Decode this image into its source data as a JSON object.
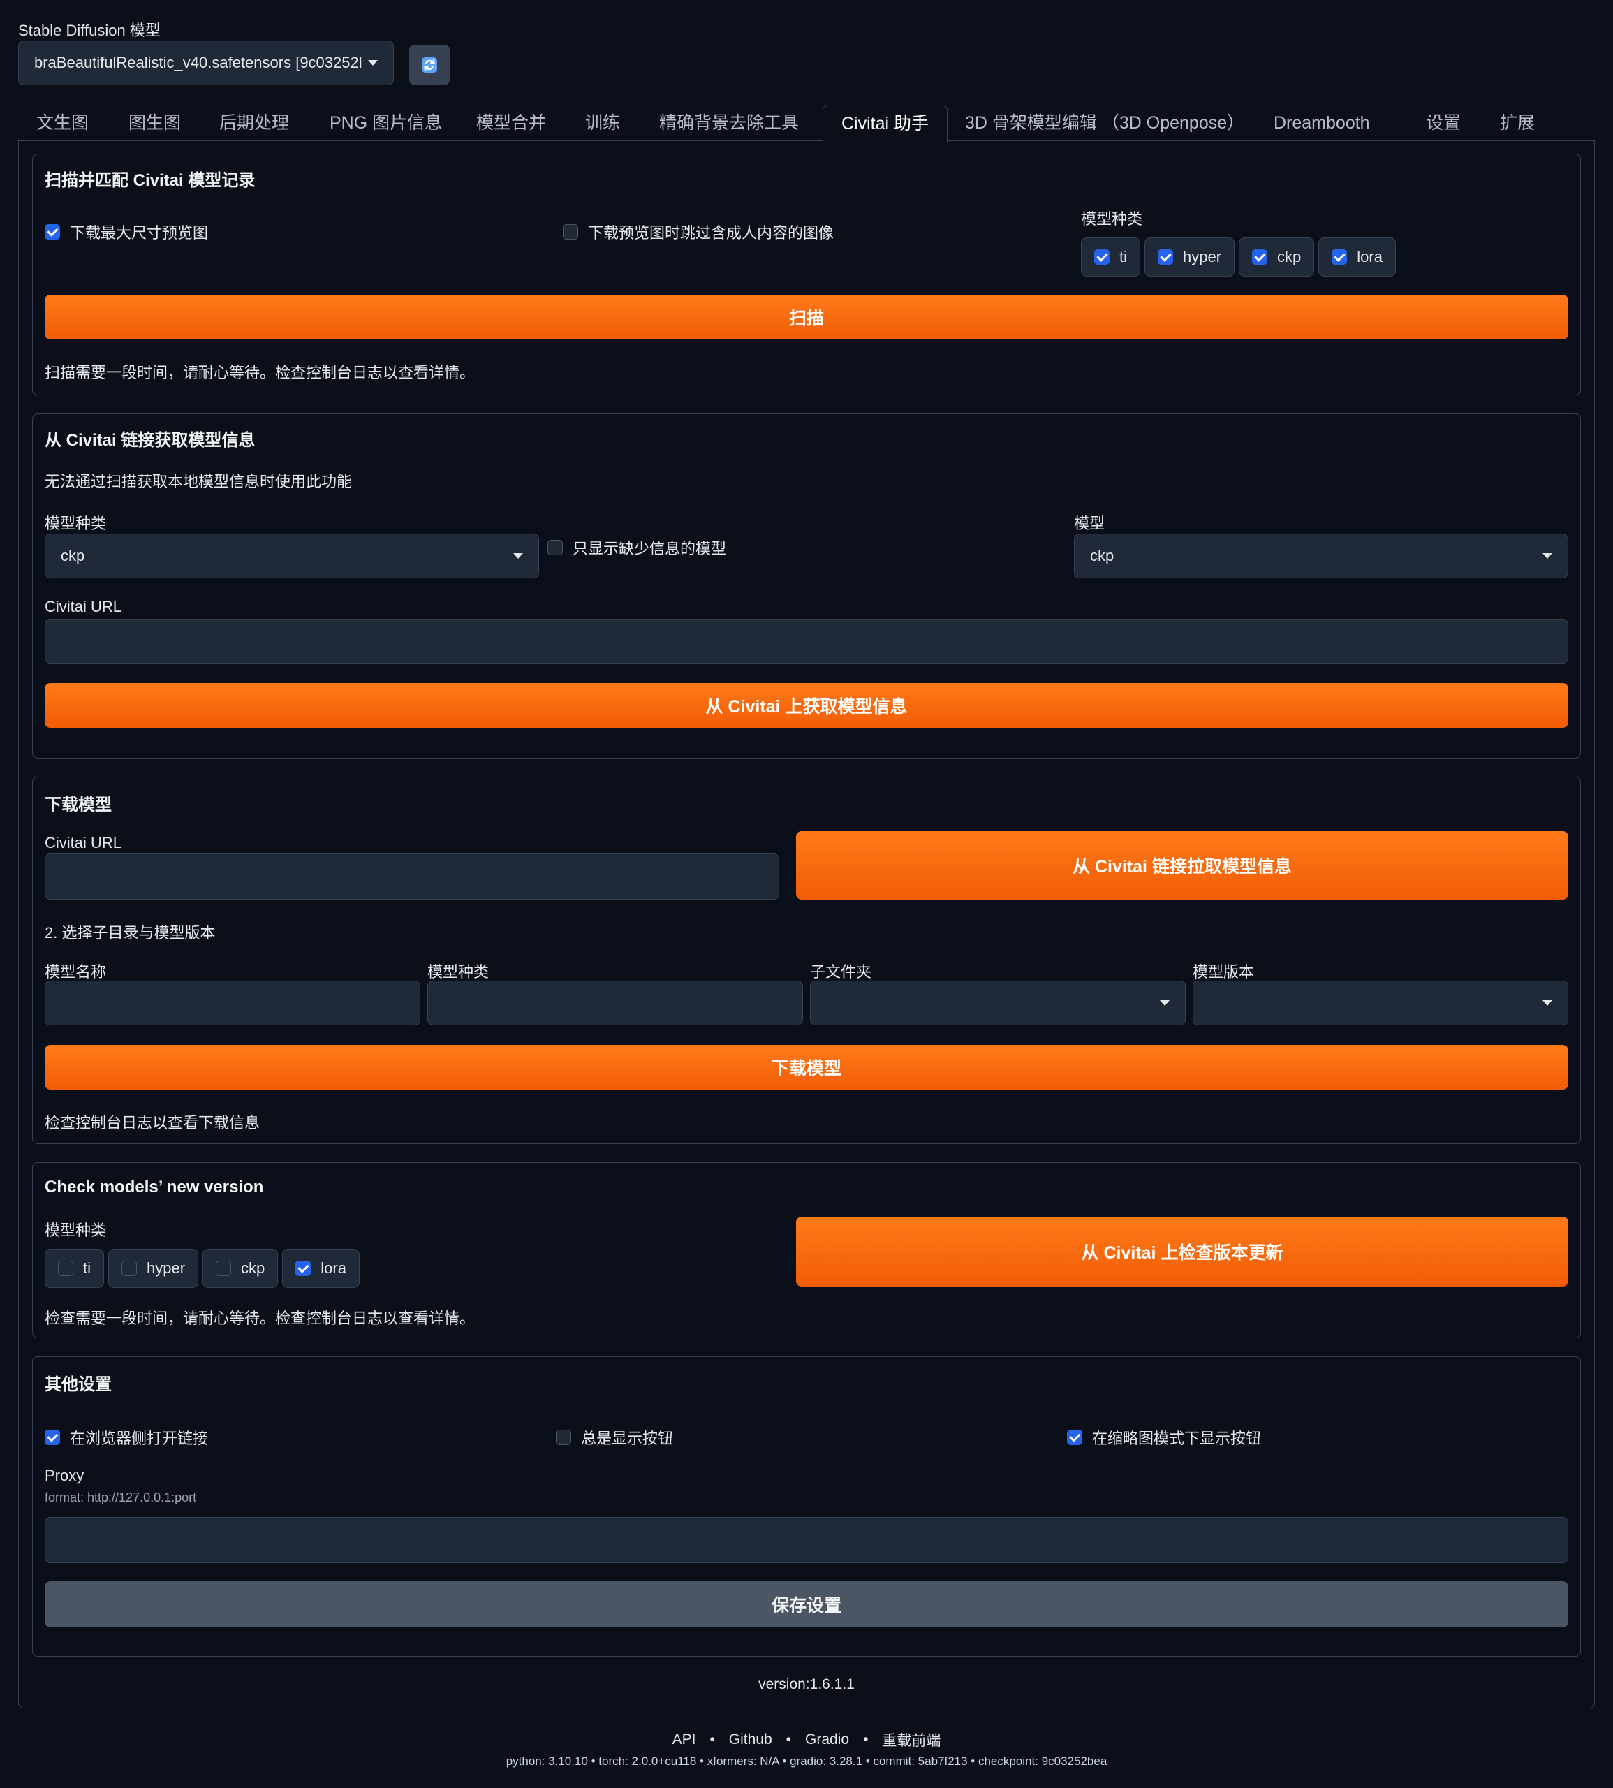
{
  "header": {
    "model_label": "Stable Diffusion 模型",
    "model_value": "braBeautifulRealistic_v40.safetensors [9c03252l",
    "refresh_icon": "refresh-icon"
  },
  "tabs": [
    {
      "label": "文生图",
      "active": false
    },
    {
      "label": "图生图",
      "active": false
    },
    {
      "label": "后期处理",
      "active": false
    },
    {
      "label": "PNG 图片信息",
      "active": false
    },
    {
      "label": "模型合并",
      "active": false
    },
    {
      "label": "训练",
      "active": false
    },
    {
      "label": "精确背景去除工具",
      "active": false
    },
    {
      "label": "Civitai 助手",
      "active": true
    },
    {
      "label": "3D 骨架模型编辑 （3D Openpose）",
      "active": false
    },
    {
      "label": "Dreambooth",
      "active": false
    },
    {
      "label": "设置",
      "active": false
    },
    {
      "label": "扩展",
      "active": false
    }
  ],
  "scan": {
    "title": "扫描并匹配 Civitai 模型记录",
    "download_max_preview": {
      "label": "下载最大尺寸预览图",
      "checked": true
    },
    "skip_nsfw": {
      "label": "下载预览图时跳过含成人内容的图像",
      "checked": false
    },
    "model_type_label": "模型种类",
    "types": [
      {
        "label": "ti",
        "checked": true
      },
      {
        "label": "hyper",
        "checked": true
      },
      {
        "label": "ckp",
        "checked": true
      },
      {
        "label": "lora",
        "checked": true
      }
    ],
    "button": "扫描",
    "note": "扫描需要一段时间，请耐心等待。检查控制台日志以查看详情。"
  },
  "fetch": {
    "title": "从 Civitai 链接获取模型信息",
    "desc": "无法通过扫描获取本地模型信息时使用此功能",
    "model_type_label": "模型种类",
    "model_type_value": "ckp",
    "only_missing": {
      "label": "只显示缺少信息的模型",
      "checked": false
    },
    "model_label": "模型",
    "model_value": "ckp",
    "url_label": "Civitai URL",
    "url_value": "",
    "button": "从 Civitai 上获取模型信息"
  },
  "download": {
    "title": "下载模型",
    "url_label": "Civitai URL",
    "url_value": "",
    "pull_button": "从 Civitai 链接拉取模型信息",
    "step2": "2. 选择子目录与模型版本",
    "name_label": "模型名称",
    "type_label": "模型种类",
    "subfolder_label": "子文件夹",
    "version_label": "模型版本",
    "button": "下载模型",
    "note": "检查控制台日志以查看下载信息"
  },
  "check": {
    "title": "Check models’ new version",
    "model_type_label": "模型种类",
    "types": [
      {
        "label": "ti",
        "checked": false
      },
      {
        "label": "hyper",
        "checked": false
      },
      {
        "label": "ckp",
        "checked": false
      },
      {
        "label": "lora",
        "checked": true
      }
    ],
    "button": "从 Civitai 上检查版本更新",
    "note": "检查需要一段时间，请耐心等待。检查控制台日志以查看详情。"
  },
  "other": {
    "title": "其他设置",
    "open_in_browser": {
      "label": "在浏览器侧打开链接",
      "checked": true
    },
    "always_show": {
      "label": "总是显示按钮",
      "checked": false
    },
    "thumb_mode": {
      "label": "在缩略图模式下显示按钮",
      "checked": true
    },
    "proxy_label": "Proxy",
    "proxy_hint": "format: http://127.0.0.1:port",
    "proxy_value": "",
    "save_button": "保存设置"
  },
  "version": "version:1.6.1.1",
  "footer": {
    "links": [
      "API",
      "Github",
      "Gradio",
      "重载前端"
    ],
    "info": "python: 3.10.10  •  torch: 2.0.0+cu118  •  xformers: N/A  •  gradio: 3.28.1  •  commit: 5ab7f213  •  checkpoint: 9c03252bea"
  },
  "colors": {
    "background": "#0b0f19",
    "accent_orange": "#f76b0c",
    "checkbox_blue": "#2563eb",
    "panel_border": "#374151"
  }
}
